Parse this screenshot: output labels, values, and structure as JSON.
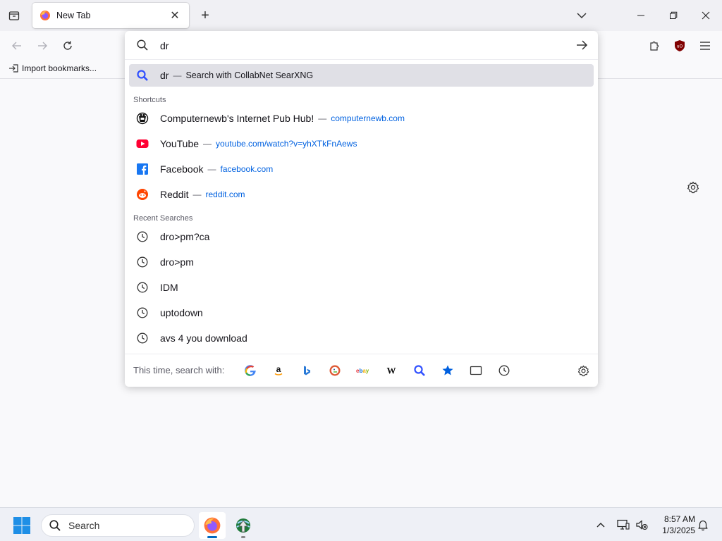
{
  "tab": {
    "title": "New Tab",
    "close_glyph": "✕"
  },
  "new_tab_glyph": "+",
  "bookmarks": {
    "import_label": "Import bookmarks..."
  },
  "urlbar": {
    "value": "dr",
    "suggestion": {
      "query": "dr",
      "separator": "—",
      "action": "Search with CollabNet SearXNG"
    },
    "shortcuts_label": "Shortcuts",
    "shortcuts": [
      {
        "title": "Computernewb's Internet Pub Hub!",
        "separator": "—",
        "url": "computernewb.com",
        "icon": "pub-hub-icon"
      },
      {
        "title": "YouTube",
        "separator": "—",
        "url": "youtube.com/watch?v=yhXTkFnAews",
        "icon": "youtube-icon"
      },
      {
        "title": "Facebook",
        "separator": "—",
        "url": "facebook.com",
        "icon": "facebook-icon"
      },
      {
        "title": "Reddit",
        "separator": "—",
        "url": "reddit.com",
        "icon": "reddit-icon"
      }
    ],
    "recent_label": "Recent Searches",
    "recent": [
      {
        "title": "dro>pm?ca"
      },
      {
        "title": "dro>pm"
      },
      {
        "title": "IDM"
      },
      {
        "title": "uptodown"
      },
      {
        "title": "avs 4 you download"
      }
    ],
    "oneoff_label": "This time, search with:",
    "oneoff_engines": [
      {
        "name": "google",
        "glyph": "G",
        "color": "#4285f4"
      },
      {
        "name": "amazon",
        "glyph": "a",
        "color": "#111111"
      },
      {
        "name": "bing",
        "glyph": "b",
        "color": "#2a7ad7"
      },
      {
        "name": "duckduckgo",
        "glyph": "",
        "color": "#de5833"
      },
      {
        "name": "ebay",
        "glyph": "ebay",
        "color": "#e53238"
      },
      {
        "name": "wikipedia",
        "glyph": "W",
        "color": "#111111"
      },
      {
        "name": "searxng",
        "glyph": "",
        "color": "#3050ff"
      },
      {
        "name": "bookmarks",
        "glyph": "",
        "color": "#0060df"
      },
      {
        "name": "tabs",
        "glyph": "",
        "color": "#333333"
      },
      {
        "name": "history",
        "glyph": "",
        "color": "#333333"
      }
    ]
  },
  "taskbar": {
    "search_label": "Search",
    "time": "8:57 AM",
    "date": "1/3/2025"
  },
  "colors": {
    "accent": "#0061e0",
    "selected_row": "#e0e0e6",
    "firefox_orange": "#ff7139"
  }
}
